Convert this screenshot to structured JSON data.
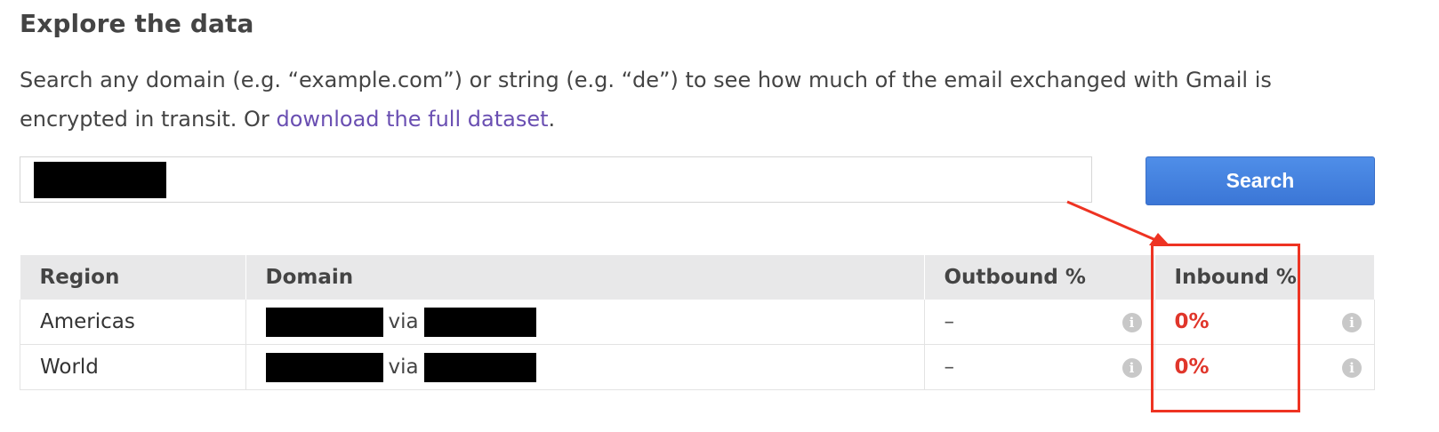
{
  "section": {
    "title": "Explore the data",
    "description_prefix": "Search any domain (e.g. “example.com”) or string (e.g. “de”) to see how much of the email exchanged with Gmail is encrypted in transit. Or ",
    "description_link": "download the full dataset",
    "description_suffix": "."
  },
  "search": {
    "placeholder": "",
    "value": "",
    "button_label": "Search"
  },
  "table": {
    "headers": [
      "Region",
      "Domain",
      "Outbound %",
      "Inbound %"
    ],
    "rows": [
      {
        "region": "Americas",
        "via": "via",
        "outbound": "–",
        "inbound": "0%"
      },
      {
        "region": "World",
        "via": "via",
        "outbound": "–",
        "inbound": "0%"
      }
    ]
  },
  "colors": {
    "link": "#6a4fb2",
    "button": "#3b76d6",
    "inbound_value": "#e0362b",
    "annotation": "#ee3322"
  },
  "icons": [
    "info-icon"
  ]
}
